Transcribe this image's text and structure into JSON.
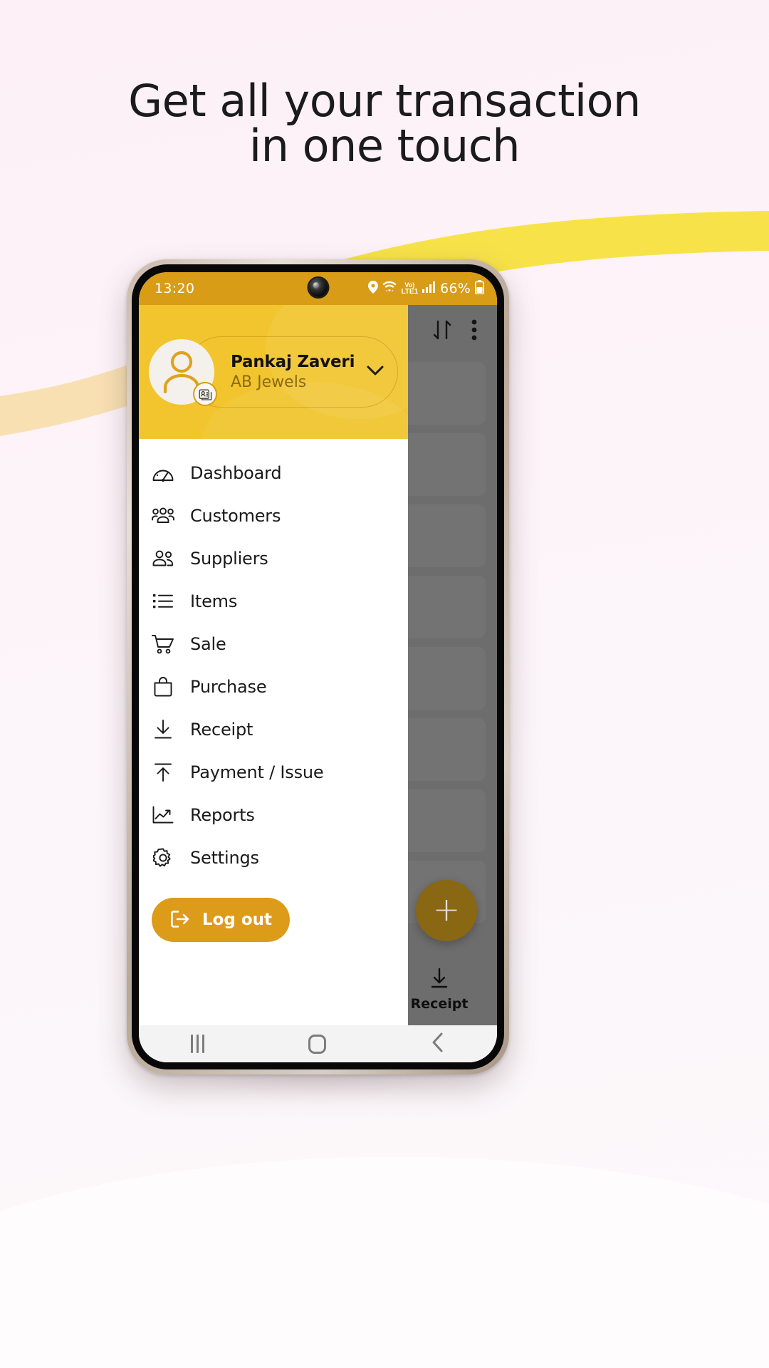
{
  "promo": {
    "headline": "Get all your transaction\nin one touch",
    "accent_yellow": "#f5e03a",
    "accent_peach": "#f7d9a8",
    "background": "#fdf3f8"
  },
  "statusbar": {
    "time": "13:20",
    "network_label": "Vo)",
    "network_sub": "LTE1",
    "battery_text": "66%",
    "icons": [
      "location-pin-icon",
      "wifi-icon",
      "signal-bars-icon",
      "battery-icon"
    ],
    "bg_color": "#d99c16"
  },
  "drawer": {
    "profile": {
      "name": "Pankaj Zaveri",
      "company": "AB Jewels",
      "avatar_icon": "person-icon",
      "badge_icon": "contact-card-icon",
      "expand_icon": "chevron-down-icon"
    },
    "menu": [
      {
        "label": "Dashboard",
        "icon": "gauge-icon"
      },
      {
        "label": "Customers",
        "icon": "users-three-icon"
      },
      {
        "label": "Suppliers",
        "icon": "users-two-icon"
      },
      {
        "label": "Items",
        "icon": "list-icon"
      },
      {
        "label": "Sale",
        "icon": "shopping-cart-icon"
      },
      {
        "label": "Purchase",
        "icon": "shopping-bag-icon"
      },
      {
        "label": "Receipt",
        "icon": "arrow-down-icon"
      },
      {
        "label": "Payment / Issue",
        "icon": "arrow-up-icon"
      },
      {
        "label": "Reports",
        "icon": "trend-chart-icon"
      },
      {
        "label": "Settings",
        "icon": "gear-icon"
      }
    ],
    "logout": {
      "label": "Log out",
      "icon": "sign-out-icon",
      "color": "#dd9b1a"
    },
    "header_color": "#f2c52f"
  },
  "background_screen": {
    "toolbar": {
      "sort_icon": "sort-arrows-icon",
      "overflow_icon": "more-vertical-icon"
    },
    "fab": {
      "label": "+",
      "icon": "plus-icon",
      "color": "#8a6712"
    },
    "bottom_nav": [
      {
        "label": "Receipt",
        "icon": "arrow-down-icon"
      }
    ]
  },
  "system_nav": {
    "recents": "recents-icon",
    "home": "home-icon",
    "back": "back-icon"
  }
}
